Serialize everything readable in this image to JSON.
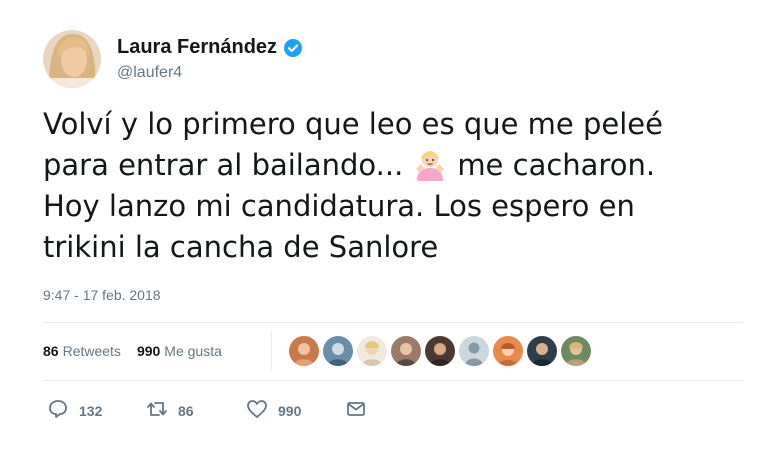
{
  "user": {
    "display_name": "Laura Fernández",
    "handle": "@laufer4",
    "verified_icon": "verified-badge-icon"
  },
  "tweet": {
    "line1": "Volví y lo primero que leo es que me peleé",
    "line2a": "para entrar al bailando...",
    "line2b": "me cacharon.",
    "line3": "Hoy lanzo mi candidatura. Los espero en",
    "line4": "trikini la cancha de Sanlore",
    "emoji": "person-shrugging-emoji",
    "timestamp": "9:47 - 17 feb. 2018"
  },
  "stats": {
    "retweets_count": "86",
    "retweets_label": "Retweets",
    "likes_count": "990",
    "likes_label": "Me gusta"
  },
  "actions": {
    "reply_count": "132",
    "retweet_count": "86",
    "like_count": "990"
  },
  "colors": {
    "accent": "#1da1f2",
    "muted": "#657786",
    "text": "#14171a",
    "divider": "#e6ecf0"
  }
}
